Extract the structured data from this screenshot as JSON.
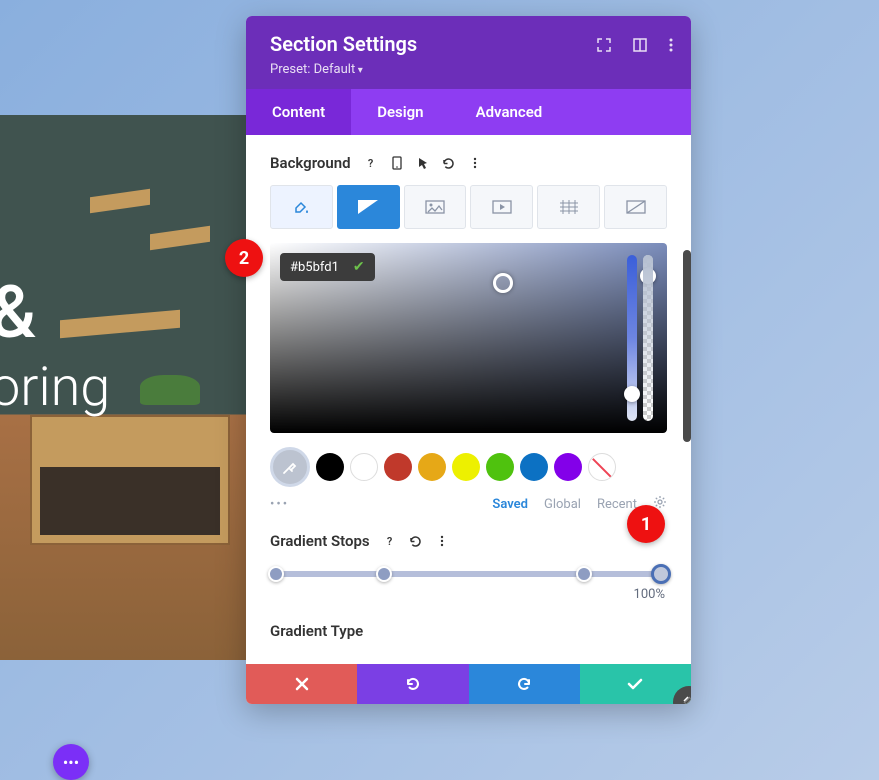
{
  "hero": {
    "line1": "&",
    "line2": "oring"
  },
  "panel": {
    "title": "Section Settings",
    "preset": "Preset: Default",
    "tabs": [
      "Content",
      "Design",
      "Advanced"
    ],
    "active_tab": 0
  },
  "background": {
    "label": "Background",
    "hex_value": "#b5bfd1",
    "hue_thumb_pct": 79,
    "alpha_thumb_pct": 8,
    "swatches": [
      {
        "name": "eyedropper",
        "type": "eyedrop"
      },
      {
        "name": "black",
        "color": "#000000"
      },
      {
        "name": "white",
        "color": "#ffffff",
        "type": "white"
      },
      {
        "name": "red",
        "color": "#c0392b"
      },
      {
        "name": "orange",
        "color": "#e6a817"
      },
      {
        "name": "yellow",
        "color": "#edf000"
      },
      {
        "name": "green",
        "color": "#4fc20e"
      },
      {
        "name": "blue",
        "color": "#0c71c3"
      },
      {
        "name": "purple",
        "color": "#8300e9"
      },
      {
        "name": "none",
        "type": "striped"
      }
    ],
    "palette_links": {
      "saved": "Saved",
      "global": "Global",
      "recent": "Recent"
    }
  },
  "gradient": {
    "label": "Gradient Stops",
    "stops_pct": [
      0,
      28,
      80,
      100
    ],
    "active_stop": 3,
    "readout": "100%",
    "type_label": "Gradient Type"
  },
  "callouts": {
    "c1": "1",
    "c2": "2"
  }
}
